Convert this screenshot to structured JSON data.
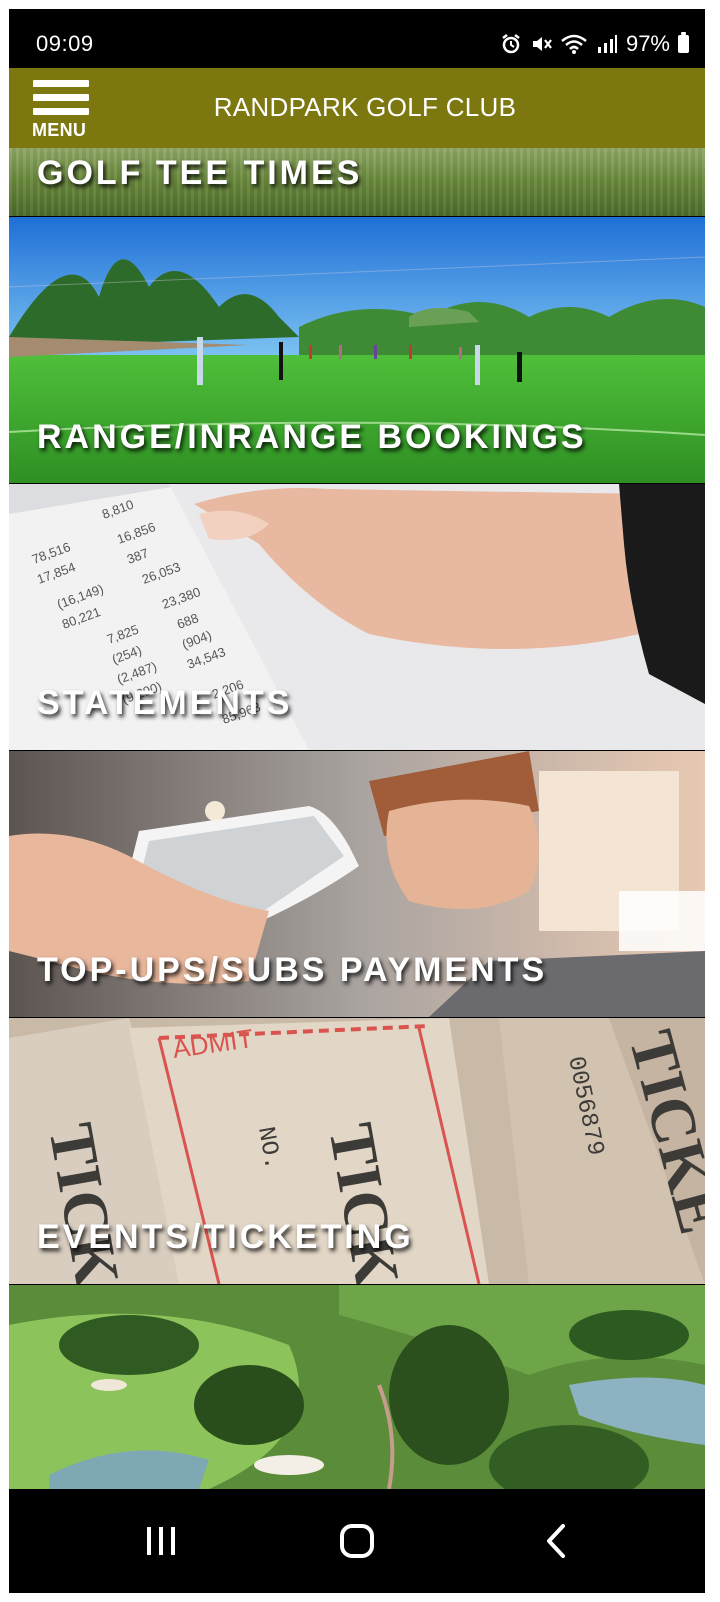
{
  "status": {
    "time": "09:09",
    "battery": "97%",
    "icons": [
      "alarm-icon",
      "mute-icon",
      "wifi-icon",
      "signal-icon",
      "battery-icon"
    ]
  },
  "header": {
    "menu_label": "MENU",
    "title": "RANDPARK GOLF CLUB",
    "color": "#7c770f"
  },
  "tiles": [
    {
      "label": "GOLF TEE TIMES"
    },
    {
      "label": "RANGE/INRANGE BOOKINGS"
    },
    {
      "label": "STATEMENTS"
    },
    {
      "label": "TOP-UPS/SUBS PAYMENTS"
    },
    {
      "label": "EVENTS/TICKETING"
    },
    {
      "label": ""
    }
  ],
  "nav": {
    "icons": [
      "recent-apps-icon",
      "home-icon",
      "back-icon"
    ]
  }
}
